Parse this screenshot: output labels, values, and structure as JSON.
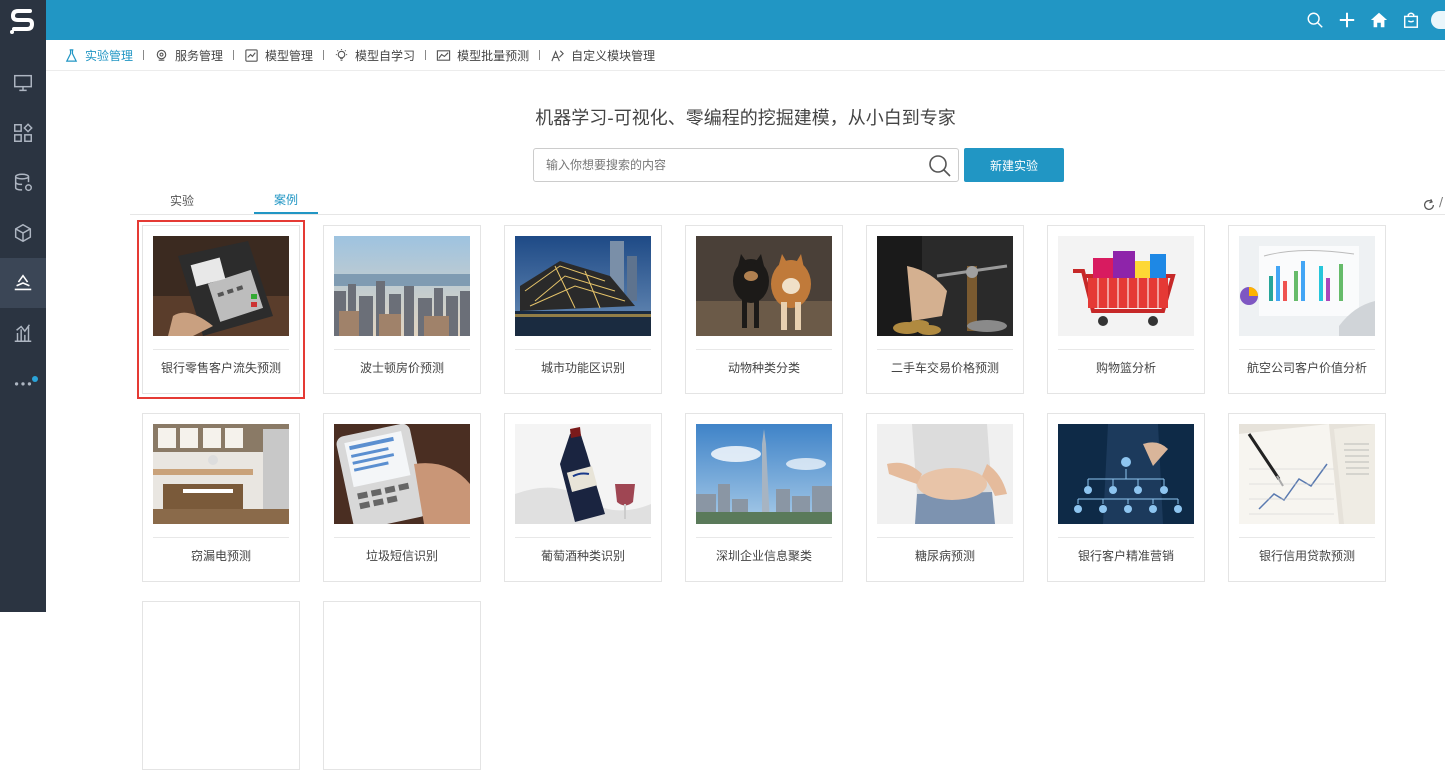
{
  "topbar": {
    "icons": [
      "search-icon",
      "plus-icon",
      "home-icon",
      "bag-icon",
      "user-avatar"
    ]
  },
  "sidebar": {
    "logo": "S",
    "items": [
      "monitor-icon",
      "apps-icon",
      "database-gear-icon",
      "cube-icon",
      "ml-active-icon",
      "bar-chart-icon",
      "more-icon"
    ]
  },
  "nav": {
    "items": [
      {
        "label": "实验管理",
        "icon": "flask-icon",
        "active": true
      },
      {
        "label": "服务管理",
        "icon": "service-icon"
      },
      {
        "label": "模型管理",
        "icon": "model-icon"
      },
      {
        "label": "模型自学习",
        "icon": "bulb-icon"
      },
      {
        "label": "模型批量预测",
        "icon": "batch-chart-icon"
      },
      {
        "label": "自定义模块管理",
        "icon": "custom-module-icon"
      }
    ]
  },
  "main": {
    "headline": "机器学习-可视化、零编程的挖掘建模，从小白到专家",
    "search": {
      "placeholder": "输入你想要搜索的内容",
      "value": ""
    },
    "new_button": "新建实验",
    "tabs": [
      "实验",
      "案例"
    ],
    "active_tab": "案例",
    "edge_fragment": "/"
  },
  "cards": [
    {
      "label": "银行零售客户流失预测",
      "selected": true
    },
    {
      "label": "波士顿房价预测"
    },
    {
      "label": "城市功能区识别"
    },
    {
      "label": "动物种类分类"
    },
    {
      "label": "二手车交易价格预测"
    },
    {
      "label": "购物篮分析"
    },
    {
      "label": "航空公司客户价值分析"
    },
    {
      "label": "窃漏电预测"
    },
    {
      "label": "垃圾短信识别"
    },
    {
      "label": "葡萄酒种类识别"
    },
    {
      "label": "深圳企业信息聚类"
    },
    {
      "label": "糖尿病预测"
    },
    {
      "label": "银行客户精准营销"
    },
    {
      "label": "银行信用贷款预测"
    },
    {
      "label": ""
    },
    {
      "label": ""
    }
  ],
  "colors": {
    "accent": "#2196c4",
    "sidebar": "#2b3441",
    "selected_outline": "#e53a34"
  }
}
